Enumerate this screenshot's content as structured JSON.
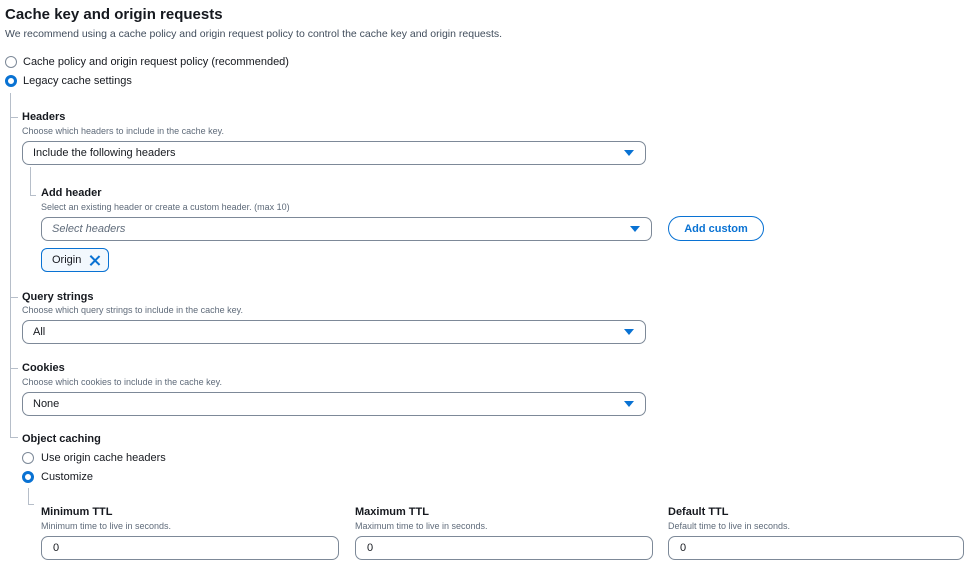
{
  "section": {
    "title": "Cache key and origin requests",
    "description": "We recommend using a cache policy and origin request policy to control the cache key and origin requests."
  },
  "mode_options": [
    {
      "label": "Cache policy and origin request policy (recommended)",
      "checked": false
    },
    {
      "label": "Legacy cache settings",
      "checked": true
    }
  ],
  "headers": {
    "label": "Headers",
    "description": "Choose which headers to include in the cache key.",
    "selected": "Include the following headers"
  },
  "add_header": {
    "label": "Add header",
    "description": "Select an existing header or create a custom header. (max 10)",
    "placeholder": "Select headers",
    "add_custom_label": "Add custom",
    "tokens": [
      "Origin"
    ]
  },
  "query_strings": {
    "label": "Query strings",
    "description": "Choose which query strings to include in the cache key.",
    "selected": "All"
  },
  "cookies": {
    "label": "Cookies",
    "description": "Choose which cookies to include in the cache key.",
    "selected": "None"
  },
  "object_caching": {
    "label": "Object caching",
    "options": [
      {
        "label": "Use origin cache headers",
        "checked": false
      },
      {
        "label": "Customize",
        "checked": true
      }
    ]
  },
  "ttl": {
    "minimum": {
      "label": "Minimum TTL",
      "description": "Minimum time to live in seconds.",
      "value": "0"
    },
    "maximum": {
      "label": "Maximum TTL",
      "description": "Maximum time to live in seconds.",
      "value": "0"
    },
    "default": {
      "label": "Default TTL",
      "description": "Default time to live in seconds.",
      "value": "0"
    }
  },
  "colors": {
    "accent": "#0972d3",
    "text": "#16191f",
    "border": "#7d8998"
  },
  "icons": {
    "dropdown": "caret-down-icon",
    "remove_token": "close-icon"
  }
}
